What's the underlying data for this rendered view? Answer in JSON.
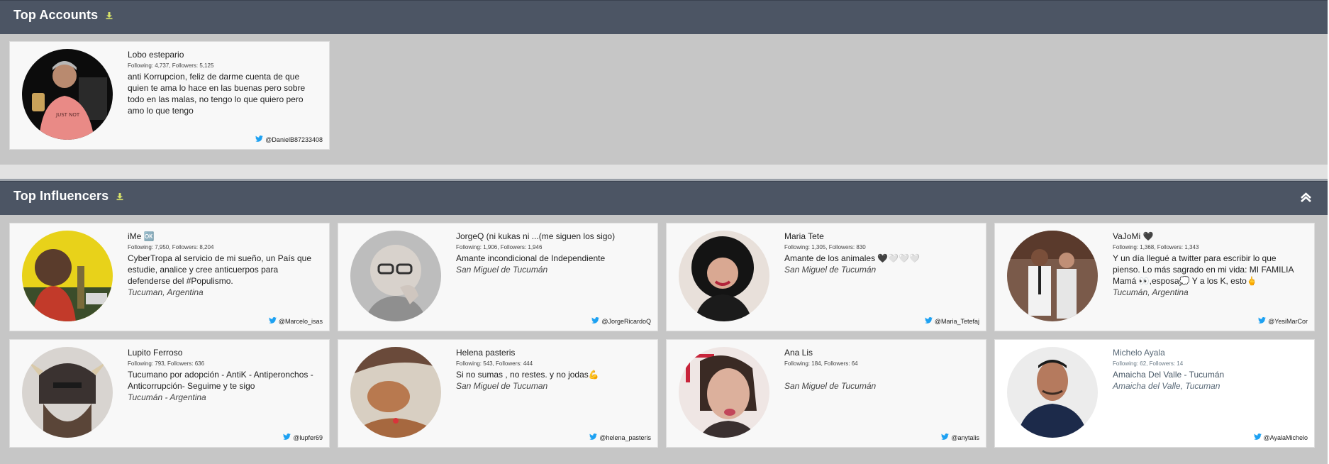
{
  "colors": {
    "header": "#4c5564",
    "section_bg": "#c6c6c6",
    "twitter": "#1da1f2",
    "download": "#d8e36a"
  },
  "top_accounts": {
    "title": "Top Accounts",
    "download_icon": "download-icon",
    "cards": [
      {
        "name": "Lobo estepario",
        "stats": "Following: 4,737, Followers: 5,125",
        "bio": "anti Korrupcion, feliz de darme cuenta de que quien te ama lo hace en las buenas pero sobre todo en las malas, no tengo lo que quiero pero amo lo que tengo",
        "location": "",
        "handle": "@DanielB87233408"
      }
    ]
  },
  "top_influencers": {
    "title": "Top Influencers",
    "download_icon": "download-icon",
    "collapse_icon": "chevron-up-icon",
    "cards": [
      {
        "name": "iMe 🆗",
        "stats": "Following: 7,950, Followers: 8,204",
        "bio": "CyberTropa al servicio de mi sueño, un País que estudie, analice y cree anticuerpos para defenderse del #Populismo.",
        "location": "Tucuman, Argentina",
        "handle": "@Marcelo_isas"
      },
      {
        "name": "JorgeQ (ni kukas ni ...(me siguen los sigo)",
        "stats": "Following: 1,906, Followers: 1,946",
        "bio": "Amante incondicional de Independiente",
        "location": "San Miguel de Tucumán",
        "handle": "@JorgeRicardoQ"
      },
      {
        "name": "Maria Tete",
        "stats": "Following: 1,305, Followers: 830",
        "bio": "Amante de los animales 🖤🤍🤍🤍",
        "location": "San Miguel de Tucumán",
        "handle": "@Maria_Tetefaj"
      },
      {
        "name": "VaJoMi 🖤",
        "stats": "Following: 1,368, Followers: 1,343",
        "bio": "Y un día llegué a twitter para escribir lo que pienso. Lo más sagrado en mi vida: MI FAMILIA Mamá 👀,esposa💭 Y a los K, esto🖕",
        "location": "Tucumán, Argentina",
        "handle": "@YesiMarCor"
      },
      {
        "name": "Lupito Ferroso",
        "stats": "Following: 793, Followers: 636",
        "bio": "Tucumano por adopción - AntiK - Antiperonchos - Anticorrupción- Seguime y te sigo",
        "location": "Tucumán - Argentina",
        "handle": "@lupfer69"
      },
      {
        "name": "Helena pasteris",
        "stats": "Following: 543, Followers: 444",
        "bio": "Si no sumas , no restes. y no jodas💪",
        "location": "San Miguel de Tucuman",
        "handle": "@helena_pasteris"
      },
      {
        "name": "Ana Lis",
        "stats": "Following: 184, Followers: 64",
        "bio": "",
        "location": "San Miguel de Tucumán",
        "handle": "@anytalis"
      },
      {
        "name": "Michelo Ayala",
        "stats": "Following: 62, Followers: 14",
        "bio": "Amaicha Del Valle - Tucumán",
        "location": "Amaicha del Valle, Tucuman",
        "handle": "@AyalaMichelo"
      }
    ]
  }
}
